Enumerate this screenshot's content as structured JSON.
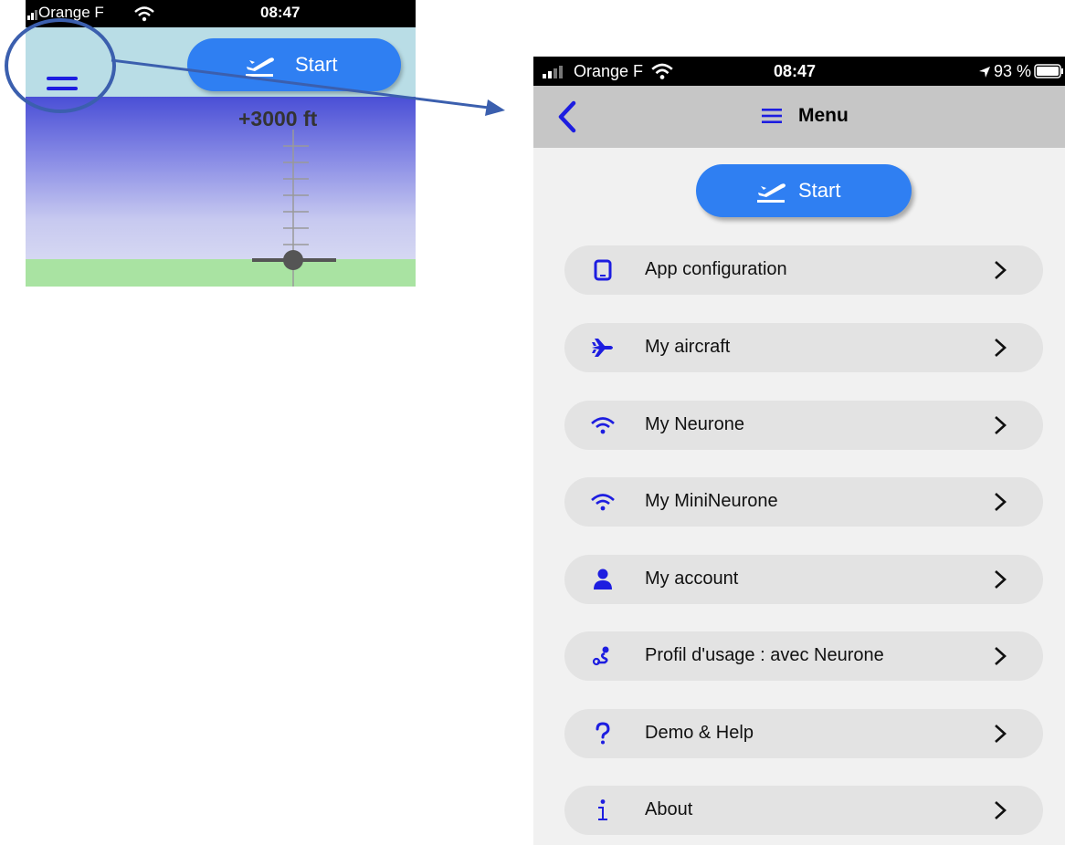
{
  "left_screen": {
    "carrier": "Orange F",
    "time": "08:47",
    "start_label": "Start",
    "altitude": "+3000 ft"
  },
  "right_screen": {
    "carrier": "Orange F",
    "time": "08:47",
    "battery": "93 %",
    "nav_title": "Menu",
    "start_label": "Start",
    "menu_items": [
      {
        "label": "App configuration",
        "icon": "tablet-icon"
      },
      {
        "label": "My aircraft",
        "icon": "airplane-icon"
      },
      {
        "label": "My Neurone",
        "icon": "wifi-icon"
      },
      {
        "label": "My MiniNeurone",
        "icon": "wifi-icon"
      },
      {
        "label": "My account",
        "icon": "user-icon"
      },
      {
        "label": "Profil d'usage : avec Neurone",
        "icon": "route-icon"
      },
      {
        "label": "Demo & Help",
        "icon": "question-icon"
      },
      {
        "label": "About",
        "icon": "info-icon"
      }
    ]
  },
  "colors": {
    "accent": "#2f7ff2",
    "icon_blue": "#1d1de0",
    "nav_bar": "#c6c6c6",
    "menu_item_bg": "#e3e3e3",
    "annotation": "#3b5fae"
  }
}
